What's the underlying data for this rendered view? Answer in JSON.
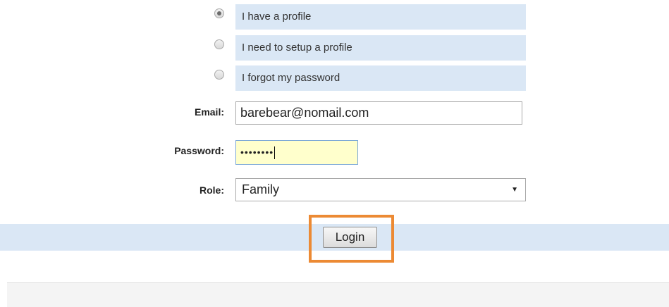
{
  "profile_options": [
    {
      "label": "I have a profile",
      "checked": true
    },
    {
      "label": "I need to setup a profile",
      "checked": false
    },
    {
      "label": "I forgot my password",
      "checked": false
    }
  ],
  "form": {
    "email_label": "Email:",
    "email_value": "barebear@nomail.com",
    "password_label": "Password:",
    "password_value": "••••••••",
    "role_label": "Role:",
    "role_value": "Family",
    "role_arrow": "▼"
  },
  "login": {
    "button_label": "Login",
    "highlight_color": "#ec8a34"
  },
  "colors": {
    "band": "#dae7f5",
    "password_bg": "#ffffcc"
  }
}
